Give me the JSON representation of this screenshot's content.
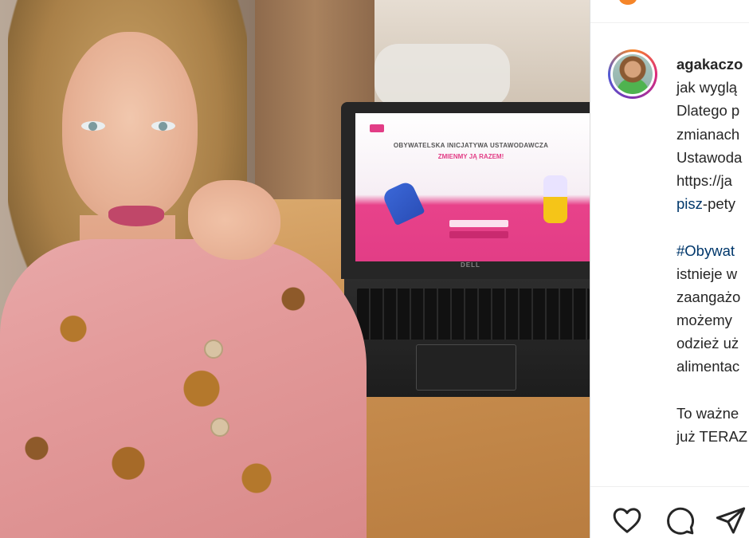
{
  "post": {
    "username": "agakaczo",
    "caption_lines": [
      "jak wyglą",
      "Dlatego p",
      "zmianach",
      "Ustawoda",
      "https://ja",
      "-pety"
    ],
    "caption_link_part": "pisz",
    "hashtag_line": "#Obywat",
    "caption_lines_2": [
      "istnieje w",
      "zaangażo",
      "możemy",
      "odzież uż",
      "alimentac"
    ],
    "caption_lines_3": [
      "To ważne",
      "już TERAZ"
    ]
  },
  "laptop": {
    "screen_title": "OBYWATELSKA INICJATYWA USTAWODAWCZA",
    "screen_subtitle": "ZMIENMY JĄ RAZEM!",
    "brand": "DELL"
  },
  "actions": {
    "like_icon": "heart-icon",
    "comment_icon": "comment-icon",
    "share_icon": "send-icon"
  },
  "colors": {
    "link": "#00376b",
    "text": "#262626",
    "accent_pink": "#e23d86"
  }
}
